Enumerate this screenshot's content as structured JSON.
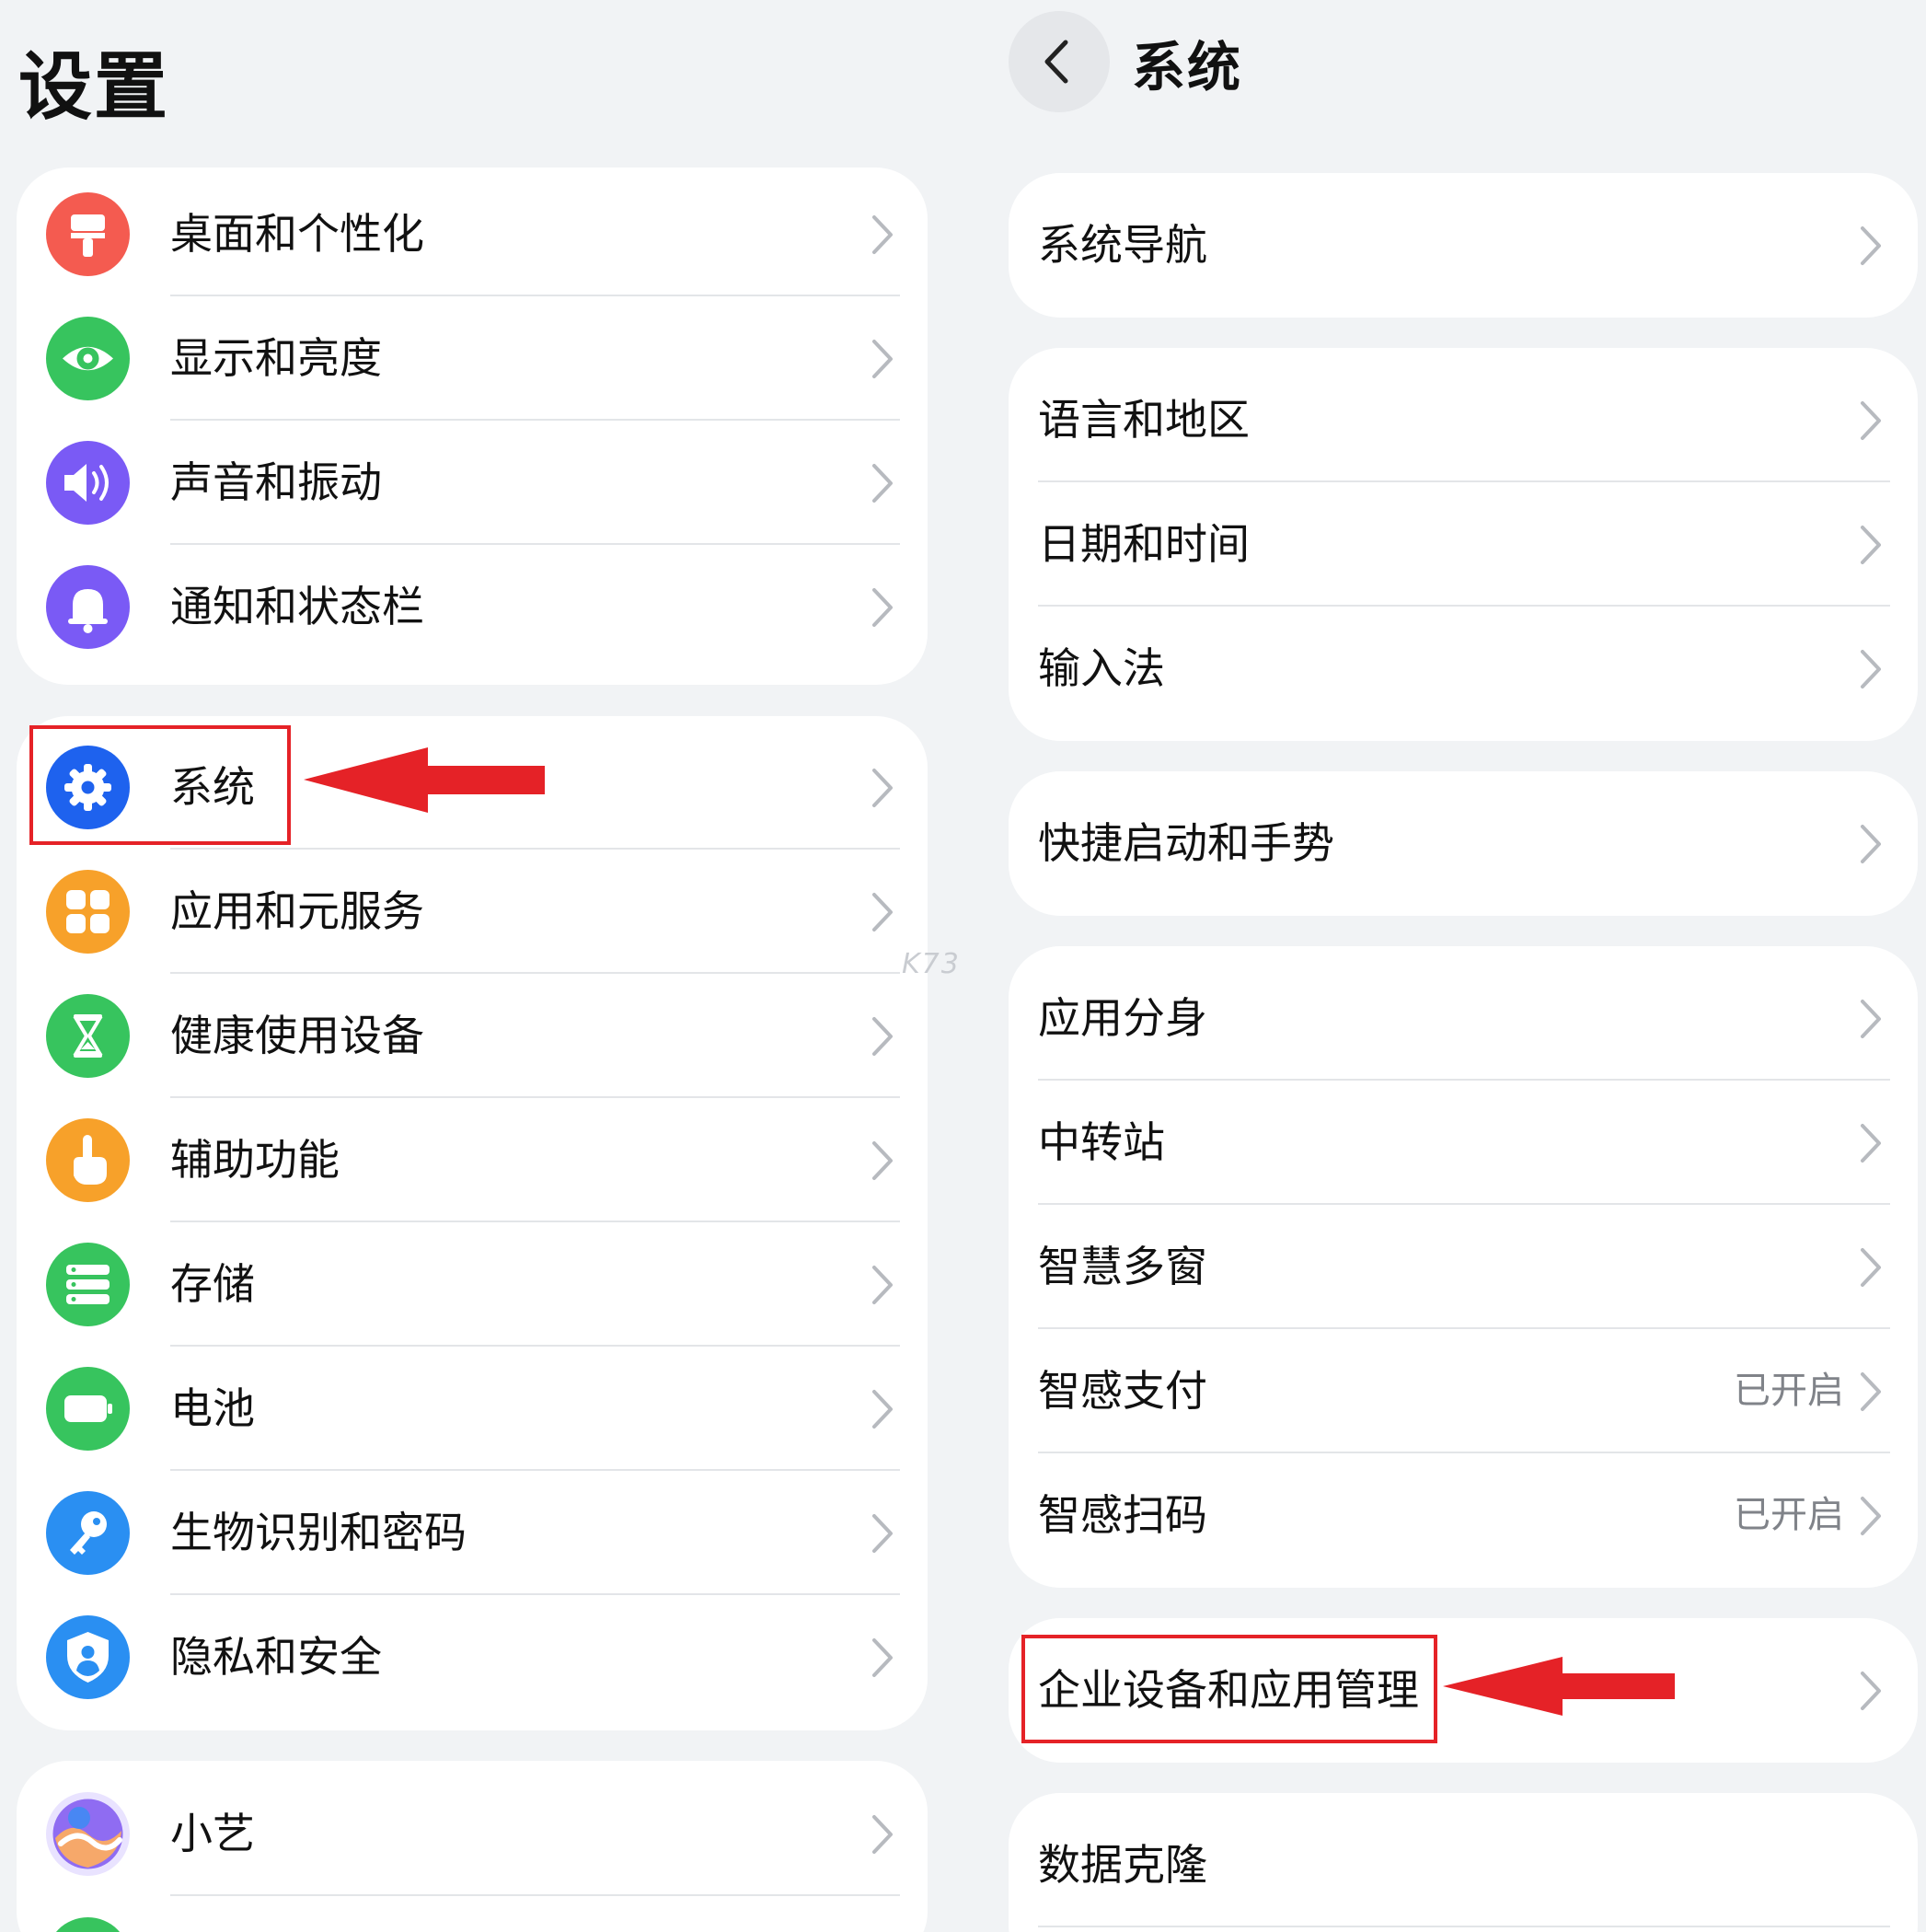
{
  "settings": {
    "title": "设置",
    "groups": [
      {
        "items": [
          {
            "label": "桌面和个性化",
            "icon": "brush-icon",
            "color": "#f45b50"
          },
          {
            "label": "显示和亮度",
            "icon": "eye-icon",
            "color": "#37c45e"
          },
          {
            "label": "声音和振动",
            "icon": "speaker-icon",
            "color": "#7a5af5"
          },
          {
            "label": "通知和状态栏",
            "icon": "bell-icon",
            "color": "#7a5af5"
          }
        ]
      },
      {
        "items": [
          {
            "label": "系统",
            "icon": "gear-icon",
            "color": "#1e62ee"
          },
          {
            "label": "应用和元服务",
            "icon": "apps-grid-icon",
            "color": "#f7a12a"
          },
          {
            "label": "健康使用设备",
            "icon": "hourglass-icon",
            "color": "#37c45e"
          },
          {
            "label": "辅助功能",
            "icon": "hand-pointer-icon",
            "color": "#f7a12a"
          },
          {
            "label": "存储",
            "icon": "storage-icon",
            "color": "#37c45e"
          },
          {
            "label": "电池",
            "icon": "battery-icon",
            "color": "#37c45e"
          },
          {
            "label": "生物识别和密码",
            "icon": "key-icon",
            "color": "#2a8ff2"
          },
          {
            "label": "隐私和安全",
            "icon": "shield-user-icon",
            "color": "#2a8ff2"
          }
        ]
      },
      {
        "items": [
          {
            "label": "小艺",
            "icon": "assistant-orb-icon",
            "color": "#9b7bf3"
          }
        ]
      }
    ]
  },
  "system": {
    "title": "系统",
    "groups": [
      {
        "items": [
          {
            "label": "系统导航",
            "value": ""
          }
        ]
      },
      {
        "items": [
          {
            "label": "语言和地区",
            "value": ""
          },
          {
            "label": "日期和时间",
            "value": ""
          },
          {
            "label": "输入法",
            "value": ""
          }
        ]
      },
      {
        "items": [
          {
            "label": "快捷启动和手势",
            "value": ""
          }
        ]
      },
      {
        "items": [
          {
            "label": "应用分身",
            "value": ""
          },
          {
            "label": "中转站",
            "value": ""
          },
          {
            "label": "智慧多窗",
            "value": ""
          },
          {
            "label": "智感支付",
            "value": "已开启"
          },
          {
            "label": "智感扫码",
            "value": "已开启"
          }
        ]
      },
      {
        "items": [
          {
            "label": "企业设备和应用管理",
            "value": ""
          }
        ]
      },
      {
        "items": [
          {
            "label": "数据克隆",
            "value": ""
          }
        ]
      }
    ]
  },
  "annotation": {
    "color": "#e52227"
  },
  "watermark": "K73"
}
